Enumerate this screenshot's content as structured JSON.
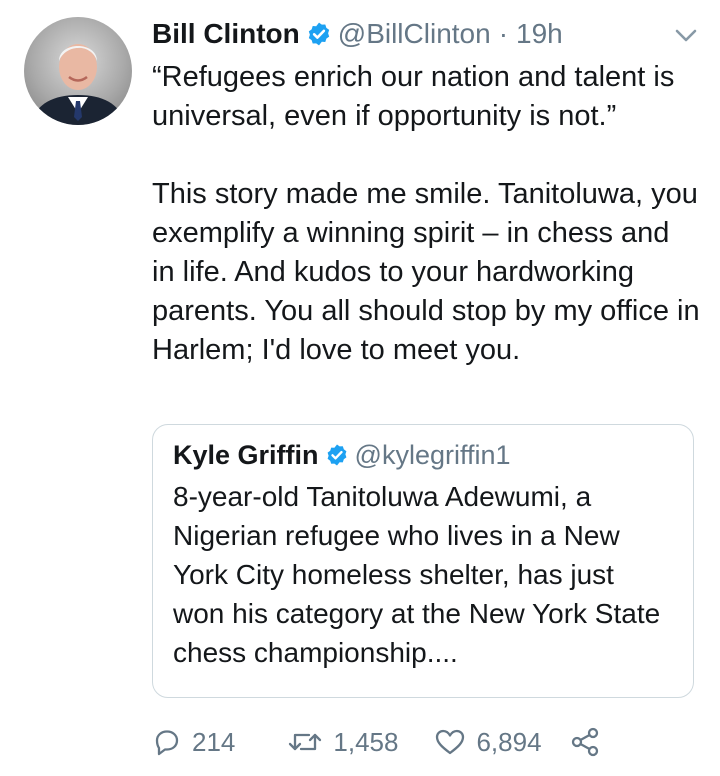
{
  "tweet": {
    "author_name": "Bill Clinton",
    "author_handle": "@BillClinton",
    "separator": "·",
    "timestamp": "19h",
    "text": "“Refugees enrich our nation and talent is universal, even if opportunity is not.”\n\nThis story made me smile. Tanitoluwa, you exemplify a winning spirit – in chess and in life. And kudos to your hardworking parents. You all should stop by my office in Harlem; I'd love to meet you."
  },
  "quoted_tweet": {
    "author_name": "Kyle Griffin",
    "author_handle": "@kylegriffin1",
    "text": "8-year-old Tanitoluwa Adewumi, a Nigerian refugee who lives in a New York City homeless shelter, has just won his category at the New York State chess championship...."
  },
  "actions": {
    "reply_count": "214",
    "retweet_count": "1,458",
    "like_count": "6,894"
  },
  "icons": {
    "verified": "verified-badge-icon",
    "caret": "chevron-down-icon",
    "reply": "reply-icon",
    "retweet": "retweet-icon",
    "like": "heart-icon",
    "share": "share-icon"
  },
  "colors": {
    "verified_blue": "#1da1f2",
    "secondary_text": "#657786",
    "border": "#cfd9de"
  }
}
